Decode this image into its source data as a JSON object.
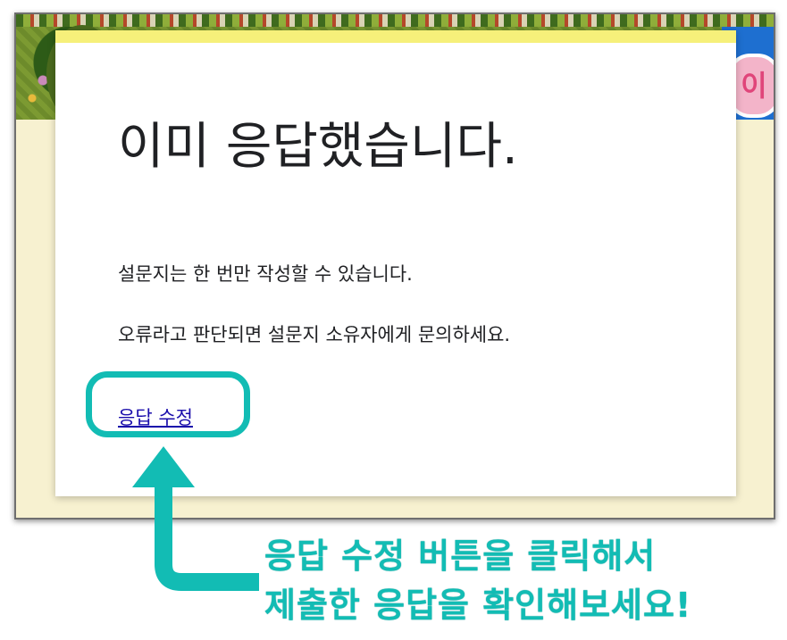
{
  "form": {
    "title": "이미 응답했습니다.",
    "message_1": "설문지는 한 번만 작성할 수 있습니다.",
    "message_2": "오류라고 판단되면 설문지 소유자에게 문의하세요.",
    "edit_link": "응답 수정"
  },
  "banner": {
    "badge_text": "이"
  },
  "annotation": {
    "line_1": "응답 수정 버튼을 클릭해서",
    "line_2": "제출한 응답을 확인해보세요!"
  },
  "colors": {
    "accent_teal": "#12bcb4",
    "card_top_bar": "#f6f07a",
    "page_background": "#f7f1d0",
    "link": "#1a0dab"
  }
}
